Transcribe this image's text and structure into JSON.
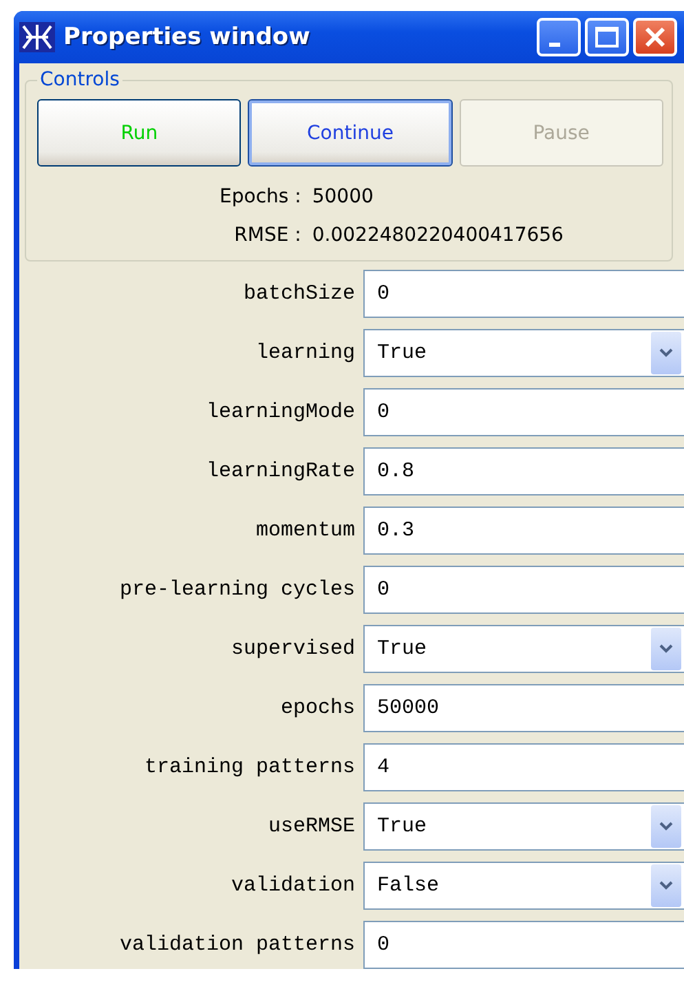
{
  "window": {
    "title": "Properties window"
  },
  "controls": {
    "title": "Controls",
    "buttons": [
      {
        "label": "Run",
        "color": "#00d000",
        "focused": false,
        "disabled": false
      },
      {
        "label": "Continue",
        "color": "#2040e0",
        "focused": true,
        "disabled": false
      },
      {
        "label": "Pause",
        "color": "#aca899",
        "focused": false,
        "disabled": true
      }
    ],
    "stats": [
      {
        "label": "Epochs :",
        "value": "50000"
      },
      {
        "label": "RMSE :",
        "value": "0.0022480220400417656"
      }
    ]
  },
  "properties": [
    {
      "label": "batchSize",
      "kind": "text",
      "value": "0"
    },
    {
      "label": "learning",
      "kind": "dropdown",
      "value": "True"
    },
    {
      "label": "learningMode",
      "kind": "text",
      "value": "0"
    },
    {
      "label": "learningRate",
      "kind": "text",
      "value": "0.8"
    },
    {
      "label": "momentum",
      "kind": "text",
      "value": "0.3"
    },
    {
      "label": "pre-learning cycles",
      "kind": "text",
      "value": "0"
    },
    {
      "label": "supervised",
      "kind": "dropdown",
      "value": "True"
    },
    {
      "label": "epochs",
      "kind": "text",
      "value": "50000"
    },
    {
      "label": "training patterns",
      "kind": "text",
      "value": "4"
    },
    {
      "label": "useRMSE",
      "kind": "dropdown",
      "value": "True"
    },
    {
      "label": "validation",
      "kind": "dropdown",
      "value": "False"
    },
    {
      "label": "validation patterns",
      "kind": "text",
      "value": "0"
    }
  ]
}
